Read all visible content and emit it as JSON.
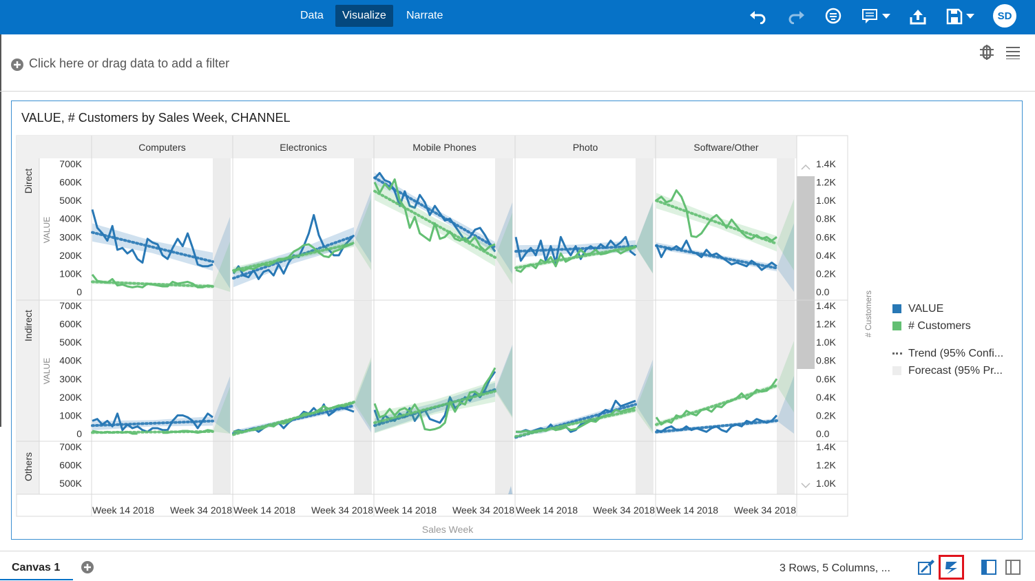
{
  "toolbar": {
    "tabs": [
      "Data",
      "Visualize",
      "Narrate"
    ],
    "active_tab": "Visualize",
    "user_initials": "SD",
    "icons": [
      "undo-icon",
      "redo-icon",
      "hints-icon",
      "comment-icon",
      "export-icon",
      "save-icon"
    ]
  },
  "filter": {
    "placeholder": "Click here or drag data to add a filter"
  },
  "viz": {
    "title": "VALUE, # Customers by Sales Week, CHANNEL",
    "x_axis_title": "Sales Week",
    "y_axis_title_left": "VALUE",
    "y_axis_title_right": "# Customers",
    "legend": [
      {
        "label": "VALUE",
        "color": "#2878b5",
        "kind": "swatch"
      },
      {
        "label": "# Customers",
        "color": "#63bf73",
        "kind": "swatch"
      },
      {
        "label": "Trend (95% Confi...",
        "kind": "dots"
      },
      {
        "label": "Forecast (95% Pr...",
        "kind": "shade"
      }
    ]
  },
  "chart_data": {
    "type": "line",
    "columns": [
      "Computers",
      "Electronics",
      "Mobile Phones",
      "Photo",
      "Software/Other"
    ],
    "rows": [
      "Direct",
      "Indirect",
      "Others"
    ],
    "x_tick_labels": [
      "Week 14 2018",
      "Week 34 2018"
    ],
    "y_ticks_left": [
      "700K",
      "600K",
      "500K",
      "400K",
      "300K",
      "200K",
      "100K",
      "0"
    ],
    "y_ticks_right": [
      "1.4K",
      "1.2K",
      "1.0K",
      "0.8K",
      "0.6K",
      "0.4K",
      "0.2K",
      "0.0"
    ],
    "y_ticks_left_others": [
      "700K",
      "600K",
      "500K"
    ],
    "y_ticks_right_others": [
      "1.4K",
      "1.2K",
      "1.0K"
    ],
    "ylim_value": [
      0,
      700000
    ],
    "ylim_customers": [
      0,
      1400
    ],
    "series": [
      {
        "name": "VALUE",
        "color": "#2878b5",
        "panels": {
          "Direct|Computers": [
            450000,
            350000,
            320000,
            280000,
            360000,
            230000,
            240000,
            210000,
            230000,
            180000,
            160000,
            290000,
            270000,
            260000,
            200000,
            180000,
            240000,
            290000,
            250000,
            320000,
            240000,
            150000,
            140000,
            140000,
            150000
          ],
          "Direct|Electronics": [
            100000,
            140000,
            90000,
            80000,
            120000,
            70000,
            110000,
            120000,
            90000,
            150000,
            100000,
            160000,
            200000,
            190000,
            250000,
            320000,
            420000,
            310000,
            250000,
            230000,
            200000,
            200000,
            250000,
            280000,
            310000
          ],
          "Direct|Mobile Phones": [
            620000,
            650000,
            610000,
            600000,
            550000,
            470000,
            550000,
            470000,
            460000,
            530000,
            490000,
            420000,
            470000,
            430000,
            390000,
            400000,
            360000,
            320000,
            280000,
            300000,
            340000,
            350000,
            310000,
            260000,
            220000
          ],
          "Direct|Photo": [
            300000,
            170000,
            210000,
            240000,
            200000,
            280000,
            170000,
            250000,
            160000,
            300000,
            240000,
            200000,
            250000,
            180000,
            230000,
            250000,
            230000,
            260000,
            240000,
            280000,
            250000,
            270000,
            300000,
            220000,
            200000
          ],
          "Direct|Software/Other": [
            260000,
            190000,
            240000,
            230000,
            250000,
            230000,
            280000,
            220000,
            210000,
            190000,
            230000,
            200000,
            210000,
            190000,
            170000,
            150000,
            160000,
            150000,
            140000,
            170000,
            150000,
            120000,
            140000,
            160000,
            140000
          ],
          "Indirect|Computers": [
            70000,
            80000,
            50000,
            70000,
            40000,
            110000,
            20000,
            50000,
            30000,
            40000,
            20000,
            10000,
            30000,
            30000,
            20000,
            20000,
            70000,
            100000,
            100000,
            90000,
            70000,
            30000,
            70000,
            110000,
            90000
          ],
          "Indirect|Electronics": [
            10000,
            20000,
            10000,
            20000,
            30000,
            10000,
            30000,
            50000,
            40000,
            60000,
            30000,
            60000,
            80000,
            90000,
            120000,
            110000,
            140000,
            110000,
            160000,
            100000,
            120000,
            150000,
            140000,
            130000,
            120000
          ],
          "Indirect|Mobile Phones": [
            130000,
            50000,
            100000,
            80000,
            70000,
            110000,
            90000,
            140000,
            70000,
            110000,
            130000,
            80000,
            70000,
            60000,
            100000,
            200000,
            140000,
            160000,
            200000,
            180000,
            220000,
            200000,
            240000,
            300000,
            340000
          ],
          "Indirect|Photo": [
            10000,
            10000,
            20000,
            10000,
            20000,
            30000,
            20000,
            50000,
            20000,
            30000,
            40000,
            10000,
            20000,
            50000,
            60000,
            80000,
            70000,
            110000,
            130000,
            120000,
            180000,
            150000,
            160000,
            170000,
            180000
          ],
          "Indirect|Software/Other": [
            20000,
            10000,
            30000,
            40000,
            20000,
            20000,
            40000,
            20000,
            30000,
            20000,
            10000,
            30000,
            40000,
            20000,
            10000,
            40000,
            50000,
            40000,
            70000,
            60000,
            80000,
            70000,
            60000,
            70000,
            100000
          ]
        }
      },
      {
        "name": "# Customers",
        "color": "#63bf73",
        "panels": {
          "Direct|Computers": [
            190,
            120,
            110,
            100,
            140,
            70,
            80,
            60,
            50,
            60,
            50,
            90,
            80,
            70,
            60,
            60,
            110,
            90,
            100,
            110,
            90,
            50,
            50,
            70,
            60
          ],
          "Direct|Electronics": [
            210,
            260,
            230,
            260,
            250,
            280,
            300,
            290,
            320,
            360,
            360,
            380,
            440,
            470,
            510,
            520,
            480,
            430,
            390,
            380,
            440,
            460,
            490,
            510,
            540
          ],
          "Direct|Mobile Phones": [
            1200,
            1080,
            1180,
            1120,
            1230,
            1000,
            920,
            700,
            820,
            640,
            600,
            560,
            750,
            580,
            600,
            660,
            580,
            560,
            590,
            540,
            600,
            500,
            450,
            500,
            520
          ],
          "Direct|Photo": [
            240,
            220,
            280,
            300,
            260,
            350,
            320,
            380,
            280,
            420,
            330,
            360,
            390,
            460,
            410,
            420,
            460,
            410,
            420,
            440,
            460,
            420,
            450,
            470,
            490
          ],
          "Direct|Software/Other": [
            1000,
            1040,
            980,
            1000,
            1110,
            1040,
            900,
            610,
            600,
            640,
            720,
            800,
            840,
            780,
            700,
            790,
            720,
            650,
            600,
            580,
            620,
            580,
            600,
            560,
            600
          ],
          "Indirect|Computers": [
            30,
            20,
            10,
            20,
            10,
            20,
            10,
            20,
            0,
            0,
            null,
            null,
            null,
            null,
            10,
            10,
            20,
            20,
            30,
            30,
            20,
            10,
            20,
            40,
            30
          ],
          "Indirect|Electronics": [
            20,
            30,
            20,
            40,
            40,
            50,
            60,
            90,
            80,
            120,
            110,
            130,
            170,
            180,
            220,
            220,
            230,
            260,
            300,
            270,
            290,
            310,
            300,
            320,
            340
          ],
          "Indirect|Mobile Phones": [
            330,
            180,
            200,
            270,
            200,
            260,
            280,
            240,
            320,
            230,
            50,
            40,
            50,
            70,
            120,
            350,
            240,
            340,
            320,
            450,
            460,
            420,
            540,
            620,
            720
          ],
          "Indirect|Photo": [
            20,
            20,
            30,
            20,
            30,
            40,
            30,
            60,
            40,
            50,
            70,
            40,
            50,
            80,
            110,
            140,
            130,
            180,
            200,
            210,
            260,
            240,
            260,
            270,
            290
          ],
          "Indirect|Software/Other": [
            180,
            100,
            140,
            120,
            200,
            180,
            250,
            220,
            200,
            260,
            270,
            240,
            300,
            290,
            340,
            360,
            390,
            440,
            380,
            420,
            480,
            460,
            470,
            520,
            600
          ]
        }
      }
    ]
  },
  "canvas": {
    "tab_label": "Canvas 1",
    "status": "3 Rows, 5 Columns, ..."
  }
}
